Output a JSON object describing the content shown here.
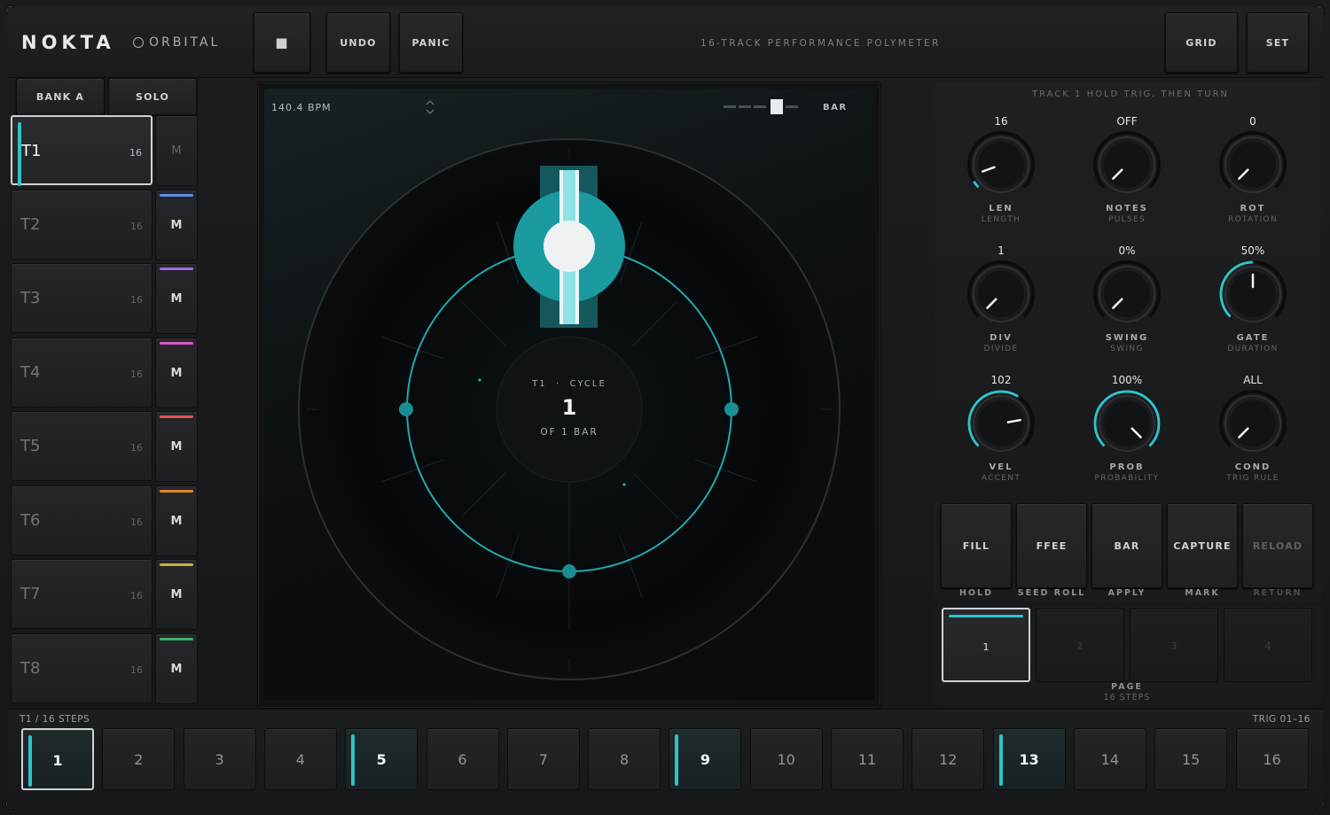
{
  "header": {
    "brand": "NOKTA",
    "mode": "ORBITAL",
    "stop_label": "■",
    "undo_label": "UNDO",
    "panic_label": "PANIC",
    "subtitle": "16-TRACK PERFORMANCE POLYMETER",
    "grid_label": "GRID",
    "set_label": "SET"
  },
  "banks": {
    "bank_label": "BANK A",
    "solo_label": "SOLO"
  },
  "tracks": [
    {
      "name": "T1",
      "steps": "16",
      "mute": "M",
      "color": "#2ec4c8"
    },
    {
      "name": "T2",
      "steps": "16",
      "mute": "M",
      "color": "#5b8ee6"
    },
    {
      "name": "T3",
      "steps": "16",
      "mute": "M",
      "color": "#9a6ee0"
    },
    {
      "name": "T4",
      "steps": "16",
      "mute": "M",
      "color": "#d85ab8"
    },
    {
      "name": "T5",
      "steps": "16",
      "mute": "M",
      "color": "#e0525e"
    },
    {
      "name": "T6",
      "steps": "16",
      "mute": "M",
      "color": "#e0862e"
    },
    {
      "name": "T7",
      "steps": "16",
      "mute": "M",
      "color": "#c8b43a"
    },
    {
      "name": "T8",
      "steps": "16",
      "mute": "M",
      "color": "#3aaf6a"
    }
  ],
  "display": {
    "bpm": "140.4  BPM",
    "bar_label": "BAR",
    "hub_track": "T1",
    "hub_sep": "·",
    "hub_label": "CYCLE",
    "hub_value": "1",
    "hub_sub": "OF 1 BAR"
  },
  "params": {
    "title": "TRACK 1    HOLD TRIG, THEN TURN",
    "knobs": [
      {
        "value": "16",
        "name": "LEN",
        "sub": "LENGTH"
      },
      {
        "value": "OFF",
        "name": "NOTES",
        "sub": "PULSES"
      },
      {
        "value": "0",
        "name": "ROT",
        "sub": "ROTATION"
      },
      {
        "value": "1",
        "name": "DIV",
        "sub": "DIVIDE"
      },
      {
        "value": "0%",
        "name": "SWING",
        "sub": "SWING"
      },
      {
        "value": "50%",
        "name": "GATE",
        "sub": "DURATION"
      },
      {
        "value": "102",
        "name": "VEL",
        "sub": "ACCENT"
      },
      {
        "value": "100%",
        "name": "PROB",
        "sub": "PROBABILITY"
      },
      {
        "value": "ALL",
        "name": "COND",
        "sub": "TRIG RULE"
      }
    ]
  },
  "actions": [
    {
      "label": "FILL",
      "sub": "HOLD"
    },
    {
      "label": "FFEE",
      "sub": "SEED  ROLL"
    },
    {
      "label": "BAR",
      "sub": "APPLY"
    },
    {
      "label": "CAPTURE",
      "sub": "MARK"
    },
    {
      "label": "RELOAD",
      "sub": "RETURN"
    }
  ],
  "pages": {
    "items": [
      "1",
      "2",
      "3",
      "4"
    ],
    "label": "PAGE",
    "sub": "16 STEPS"
  },
  "steps": {
    "left_label": "T1   /   16 STEPS",
    "right_label": "TRIG 01–16",
    "items": [
      "1",
      "2",
      "3",
      "4",
      "5",
      "6",
      "7",
      "8",
      "9",
      "10",
      "11",
      "12",
      "13",
      "14",
      "15",
      "16"
    ]
  },
  "colors": {
    "accent": "#2ec4c8",
    "panel": "#1c1d1f"
  }
}
